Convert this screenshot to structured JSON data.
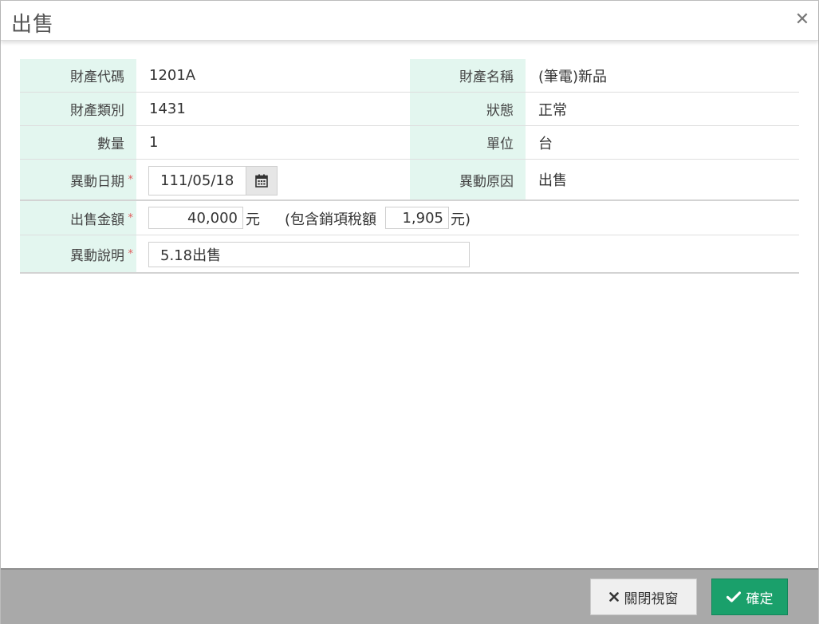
{
  "dialog": {
    "title": "出售",
    "close_symbol": "✕"
  },
  "fields": {
    "property_code": {
      "label": "財產代碼",
      "value": "1201A"
    },
    "property_name": {
      "label": "財產名稱",
      "value": "(筆電)新品"
    },
    "property_category": {
      "label": "財產類別",
      "value": "1431"
    },
    "status": {
      "label": "狀態",
      "value": "正常"
    },
    "quantity": {
      "label": "數量",
      "value": "1"
    },
    "unit": {
      "label": "單位",
      "value": "台"
    },
    "change_date": {
      "label": "異動日期",
      "value": "111/05/18",
      "required_mark": "*"
    },
    "change_reason": {
      "label": "異動原因",
      "value": "出售"
    },
    "sale_amount": {
      "label": "出售金額",
      "required_mark": "*",
      "value": "40,000",
      "unit": "元",
      "tax_prefix": "(包含銷項稅額",
      "tax_value": "1,905",
      "tax_suffix": "元)"
    },
    "change_note": {
      "label": "異動說明",
      "value": "5.18出售",
      "required_mark": "*"
    }
  },
  "footer": {
    "close_window_label": "關閉視窗",
    "confirm_label": "確定"
  },
  "icons": {
    "calendar": "calendar-icon",
    "close": "close-icon",
    "check": "check-icon"
  },
  "colors": {
    "label_bg": "#e3f6ef",
    "required": "#e05b5b",
    "confirm_bg": "#1aa06b",
    "footer_bg": "#a9a9a9"
  }
}
